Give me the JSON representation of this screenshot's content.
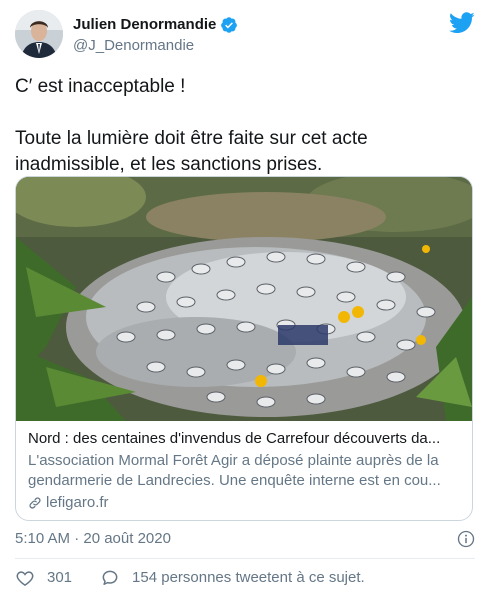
{
  "author": {
    "display_name": "Julien Denormandie",
    "handle": "@J_Denormandie"
  },
  "tweet": {
    "line1": "C′ est inacceptable !",
    "line2": "Toute la lumière doit être faite sur cet acte inadmissible, et les sanctions prises."
  },
  "card": {
    "title": "Nord : des centaines d'invendus de Carrefour découverts da...",
    "description": "L'association Mormal Forêt Agir a déposé plainte auprès de la gendarmerie de Landrecies. Une enquête interne est en cou...",
    "domain": "lefigaro.fr"
  },
  "meta": {
    "timestamp": "5:10 AM · 20 août 2020"
  },
  "actions": {
    "likes": "301",
    "replies": "154 personnes tweetent à ce sujet."
  },
  "icons": {
    "verified": "verified-badge-icon",
    "twitter": "twitter-bird-icon",
    "info": "info-icon",
    "link": "link-icon",
    "like": "heart-icon",
    "reply": "speech-bubble-icon"
  },
  "colors": {
    "accent": "#1da1f2",
    "text": "#14171a",
    "secondary": "#657786",
    "border": "#ccd6dd"
  }
}
